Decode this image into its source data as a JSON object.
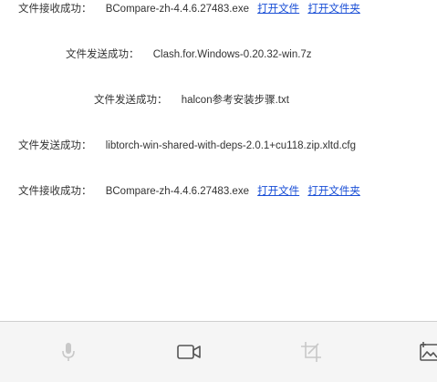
{
  "messages": [
    {
      "label": "文件接收成功：",
      "filename": "BCompare-zh-4.4.6.27483.exe",
      "links": [
        "打开文件",
        "打开文件夹"
      ]
    },
    {
      "label": "文件发送成功：",
      "filename": "Clash.for.Windows-0.20.32-win.7z"
    },
    {
      "label": "文件发送成功：",
      "filename": "halcon参考安装步骤.txt"
    },
    {
      "label": "文件发送成功：",
      "filename": "libtorch-win-shared-with-deps-2.0.1+cu118.zip.xltd.cfg"
    },
    {
      "label": "文件接收成功：",
      "filename": "BCompare-zh-4.4.6.27483.exe",
      "links": [
        "打开文件",
        "打开文件夹"
      ]
    }
  ],
  "toolbar": {
    "tools": [
      "microphone-icon",
      "video-camera-icon",
      "crop-icon",
      "image-icon"
    ]
  },
  "colors": {
    "link": "#1a4fd6",
    "text": "#333333",
    "toolbar_bg": "#f5f5f5",
    "icon_dark": "#555555",
    "icon_disabled": "#c8c8c8"
  }
}
